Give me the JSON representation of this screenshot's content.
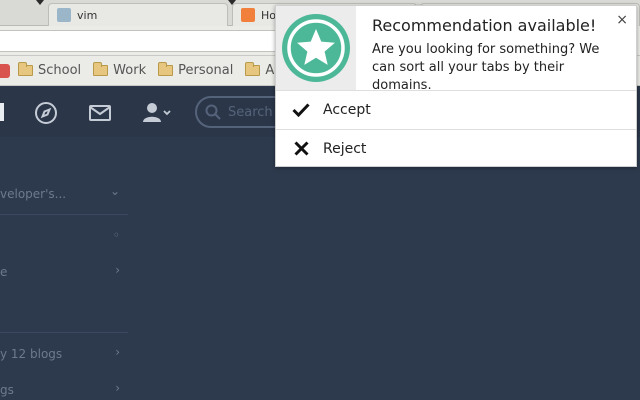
{
  "browser": {
    "tabs": [
      {
        "label": "vim"
      },
      {
        "label": "Ho"
      },
      {
        "label": ""
      }
    ],
    "bookmarks": [
      {
        "label": "School"
      },
      {
        "label": "Work"
      },
      {
        "label": "Personal"
      },
      {
        "label": "A"
      }
    ]
  },
  "app": {
    "search_placeholder": "Search",
    "sidebar": [
      {
        "label": "veloper's...",
        "chevron": "⌄"
      },
      {
        "label": "",
        "chevron": "◦"
      },
      {
        "label": "e",
        "chevron": "›"
      },
      {
        "label": "y 12 blogs",
        "chevron": "›"
      },
      {
        "label": "gs",
        "chevron": "›"
      }
    ]
  },
  "popup": {
    "title": "Recommendation available!",
    "message": "Are you looking for something? We can sort all your tabs by their domains.",
    "close_glyph": "×",
    "actions": [
      {
        "label": "Accept",
        "icon": "check-icon"
      },
      {
        "label": "Reject",
        "icon": "x-icon"
      }
    ],
    "logo_color": "#4db897",
    "logo_bg": "#ececec"
  }
}
